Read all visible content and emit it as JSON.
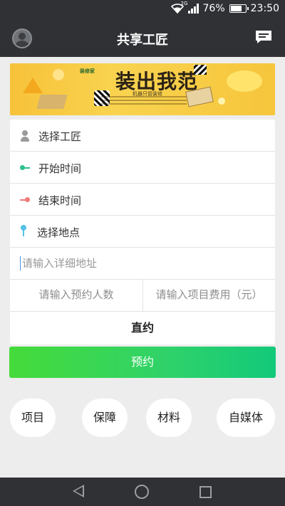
{
  "status_bar": {
    "network": "2G",
    "battery_percent": "76%",
    "battery_level": 0.76,
    "time": "23:50"
  },
  "header": {
    "title": "共享工匠",
    "left_icon": "avatar-icon",
    "right_icon": "message-icon"
  },
  "banner": {
    "logo_text": "装修家",
    "title": "装出我范",
    "subtitle": "机器只管装修"
  },
  "form": {
    "select_worker": "选择工匠",
    "start_time": "开始时间",
    "end_time": "结束时间",
    "select_location": "选择地点",
    "address_placeholder": "请输入详细地址",
    "people_placeholder": "请输入预约人数",
    "fee_placeholder": "请输入项目费用（元）",
    "direct_label": "直约"
  },
  "colors": {
    "start_time_accent": "#2ebf8a",
    "end_time_accent": "#f07a78",
    "location_accent": "#56c1e8",
    "book_button_start": "#45db3a",
    "book_button_end": "#12c97a",
    "header_bg": "#2f3135"
  },
  "book_button": {
    "label": "预约"
  },
  "quick_links": [
    {
      "label": "项目"
    },
    {
      "label": "保障"
    },
    {
      "label": "材料"
    },
    {
      "label": "自媒体"
    }
  ],
  "nav": {
    "back_icon": "back-triangle-icon",
    "home_icon": "home-circle-icon",
    "recent_icon": "recent-square-icon"
  }
}
